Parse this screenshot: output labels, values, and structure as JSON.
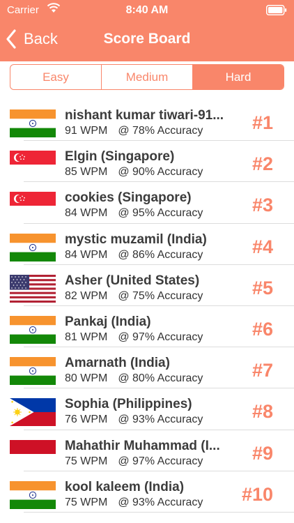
{
  "status": {
    "carrier": "Carrier",
    "time": "8:40 AM"
  },
  "nav": {
    "back_label": "Back",
    "title": "Score Board"
  },
  "tabs": [
    {
      "label": "Easy",
      "active": false
    },
    {
      "label": "Medium",
      "active": false
    },
    {
      "label": "Hard",
      "active": true
    }
  ],
  "colors": {
    "accent": "#f9866a"
  },
  "scores": [
    {
      "name": "nishant kumar tiwari-91...",
      "wpm": "91 WPM",
      "accuracy": "@ 78% Accuracy",
      "rank": "#1",
      "flag": "india"
    },
    {
      "name": "Elgin (Singapore)",
      "wpm": "85 WPM",
      "accuracy": "@ 90% Accuracy",
      "rank": "#2",
      "flag": "singapore"
    },
    {
      "name": "cookies (Singapore)",
      "wpm": "84 WPM",
      "accuracy": "@ 95% Accuracy",
      "rank": "#3",
      "flag": "singapore"
    },
    {
      "name": "mystic muzamil (India)",
      "wpm": "84 WPM",
      "accuracy": "@ 86% Accuracy",
      "rank": "#4",
      "flag": "india"
    },
    {
      "name": "Asher (United States)",
      "wpm": "82 WPM",
      "accuracy": "@ 75% Accuracy",
      "rank": "#5",
      "flag": "usa"
    },
    {
      "name": "Pankaj (India)",
      "wpm": "81 WPM",
      "accuracy": "@ 97% Accuracy",
      "rank": "#6",
      "flag": "india"
    },
    {
      "name": "Amarnath (India)",
      "wpm": "80 WPM",
      "accuracy": "@ 80% Accuracy",
      "rank": "#7",
      "flag": "india"
    },
    {
      "name": "Sophia (Philippines)",
      "wpm": "76 WPM",
      "accuracy": "@ 93% Accuracy",
      "rank": "#8",
      "flag": "philippines"
    },
    {
      "name": "Mahathir Muhammad (I...",
      "wpm": "75 WPM",
      "accuracy": "@ 97% Accuracy",
      "rank": "#9",
      "flag": "indonesia"
    },
    {
      "name": "kool kaleem (India)",
      "wpm": "75 WPM",
      "accuracy": "@ 93% Accuracy",
      "rank": "#10",
      "flag": "india"
    }
  ]
}
